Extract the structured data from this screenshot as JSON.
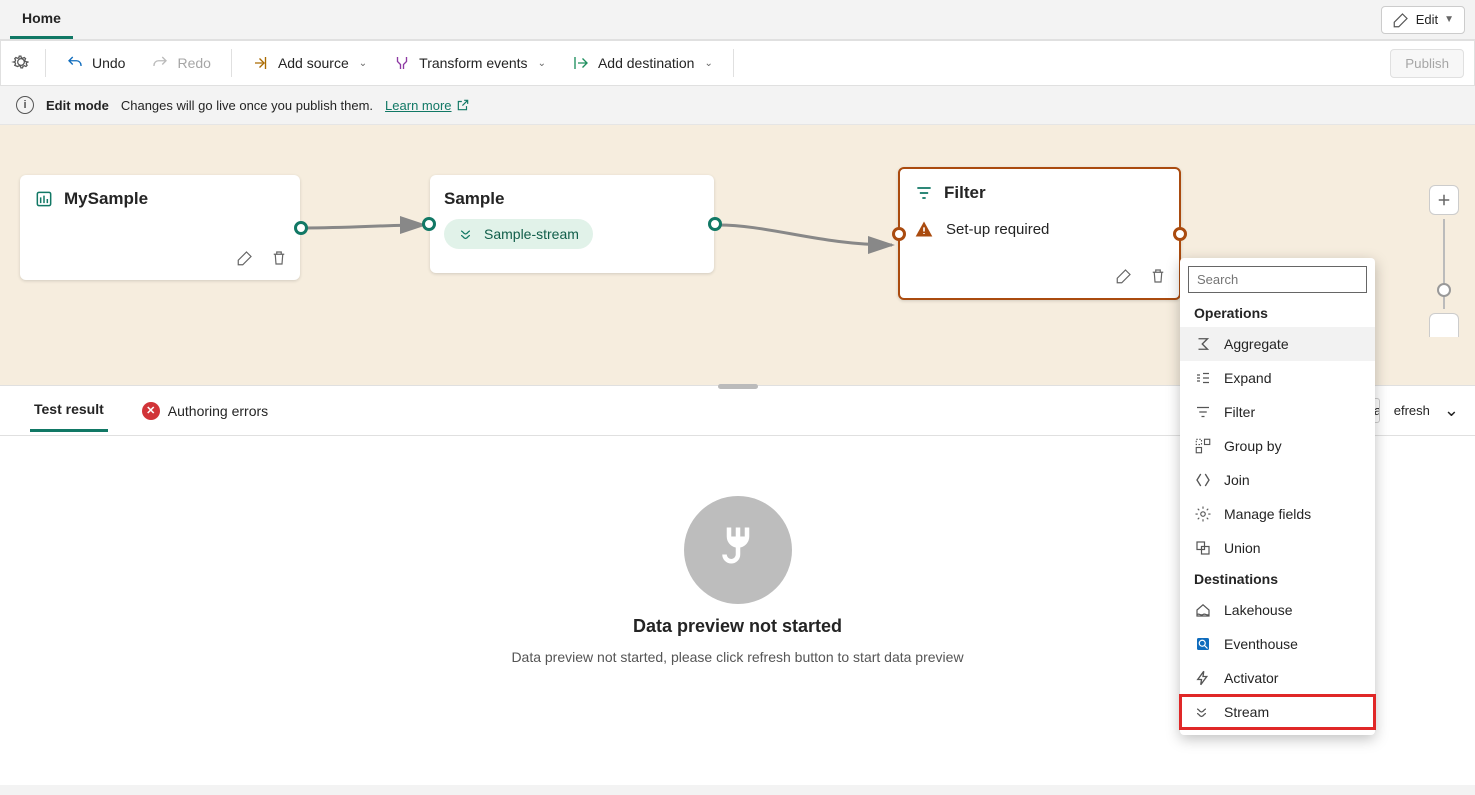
{
  "tabs": {
    "home": "Home"
  },
  "edit_toggle": "Edit",
  "toolbar": {
    "undo": "Undo",
    "redo": "Redo",
    "add_source": "Add source",
    "transform": "Transform events",
    "add_destination": "Add destination",
    "publish": "Publish"
  },
  "info": {
    "mode": "Edit mode",
    "msg": "Changes will go live once you publish them.",
    "learn": "Learn more"
  },
  "nodes": {
    "n1": {
      "title": "MySample"
    },
    "n2": {
      "title": "Sample",
      "stream": "Sample-stream"
    },
    "n3": {
      "title": "Filter",
      "status": "Set-up required"
    }
  },
  "bottom_tabs": {
    "test_result": "Test result",
    "auth_errors": "Authoring errors"
  },
  "bottom_right": {
    "la": "La",
    "refresh": "efresh"
  },
  "preview": {
    "title": "Data preview not started",
    "sub": "Data preview not started, please click refresh button to start data preview"
  },
  "dropdown": {
    "search_placeholder": "Search",
    "section_ops": "Operations",
    "section_dest": "Destinations",
    "ops": {
      "aggregate": "Aggregate",
      "expand": "Expand",
      "filter": "Filter",
      "groupby": "Group by",
      "join": "Join",
      "manage": "Manage fields",
      "union": "Union"
    },
    "dest": {
      "lakehouse": "Lakehouse",
      "eventhouse": "Eventhouse",
      "activator": "Activator",
      "stream": "Stream"
    }
  }
}
